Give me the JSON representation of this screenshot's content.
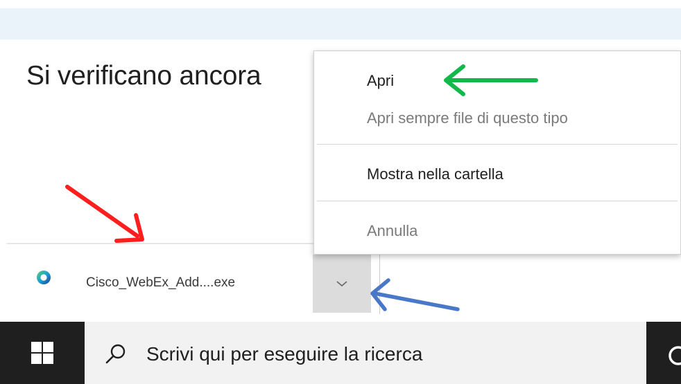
{
  "page": {
    "heading": "Si verificano ancora"
  },
  "download": {
    "file_name": "Cisco_WebEx_Add....exe",
    "icon": "webex-app-icon"
  },
  "menu": {
    "items": [
      {
        "label": "Apri",
        "enabled": true
      },
      {
        "label": "Apri sempre file di questo tipo",
        "enabled": false
      },
      {
        "label": "Mostra nella cartella",
        "enabled": true
      },
      {
        "label": "Annulla",
        "enabled": false
      }
    ]
  },
  "taskbar": {
    "search_placeholder": "Scrivi qui per eseguire la ricerca",
    "start_icon": "windows-logo-icon",
    "search_icon": "search-icon"
  },
  "annotations": {
    "colors": {
      "red": "#ff1e1e",
      "green": "#12b84a",
      "blue": "#4a78c8"
    }
  }
}
